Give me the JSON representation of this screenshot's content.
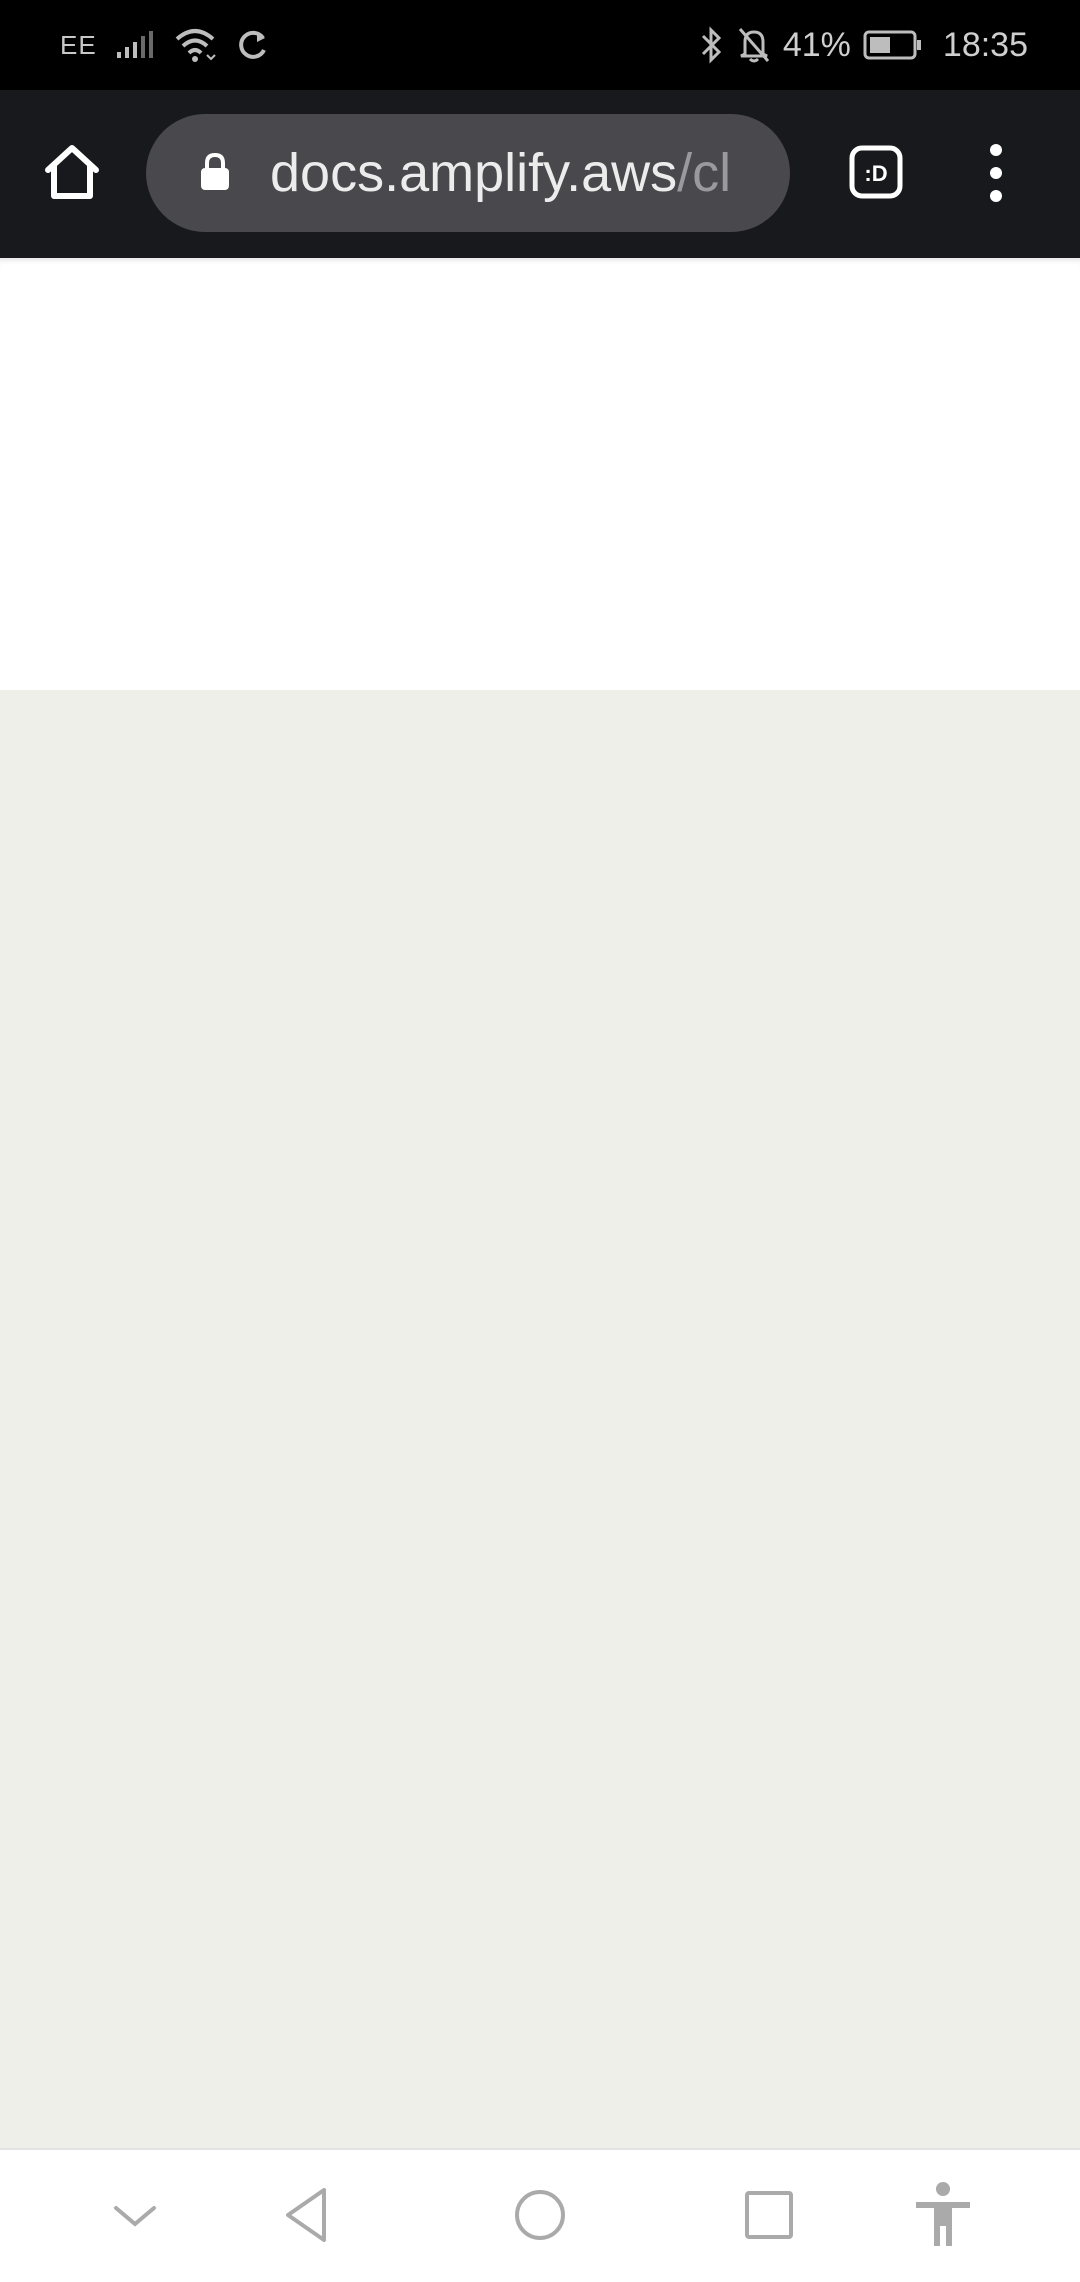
{
  "status_bar": {
    "carrier": "EE",
    "battery_percent": "41%",
    "time": "18:35"
  },
  "browser": {
    "url_host": "docs.amplify.aws",
    "url_path": "/cl",
    "tab_button_label": ":D"
  },
  "colors": {
    "status_bar_bg": "#000000",
    "toolbar_bg": "#18191c",
    "omnibox_bg": "#48484d",
    "page_content_bg": "#efefea"
  },
  "icons": {
    "home": "home-icon",
    "lock": "lock-icon",
    "tabs": "tab-switcher-icon",
    "menu": "more-vert-icon",
    "nav_down": "chevron-down-icon",
    "nav_back": "back-triangle-icon",
    "nav_home": "home-circle-icon",
    "nav_recents": "recents-square-icon",
    "accessibility": "accessibility-icon"
  }
}
